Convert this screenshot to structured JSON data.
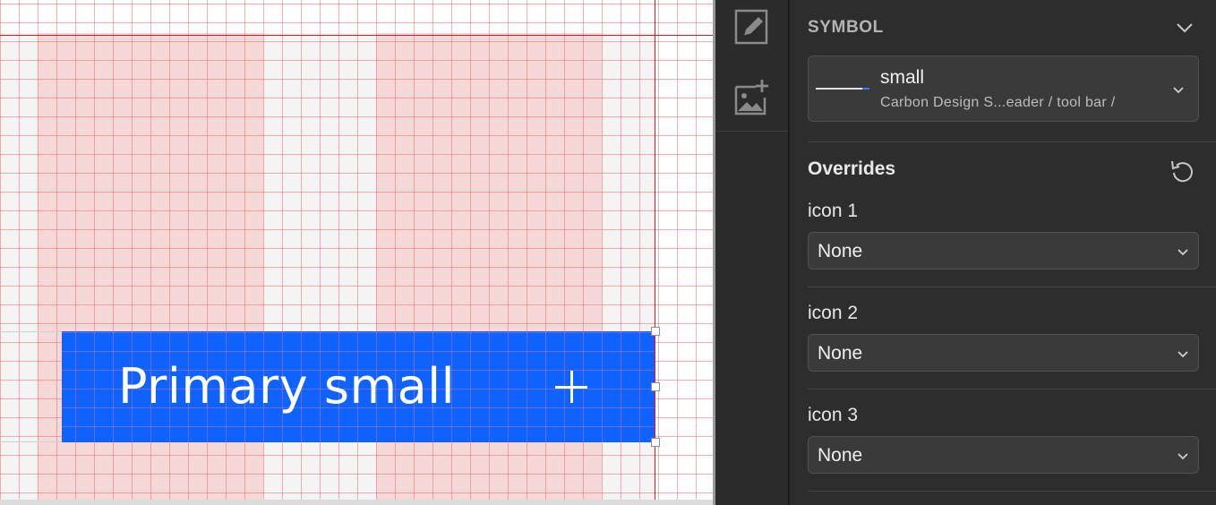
{
  "canvas": {
    "button_label": "Primary small"
  },
  "toolbar": {
    "tools": [
      {
        "name": "edit-symbol"
      },
      {
        "name": "add-image"
      }
    ]
  },
  "inspector": {
    "section_title": "SYMBOL",
    "symbol": {
      "name": "small",
      "path": "Carbon Design S...eader / tool bar /"
    },
    "overrides": {
      "title": "Overrides",
      "items": [
        {
          "label": "icon 1",
          "value": "None"
        },
        {
          "label": "icon 2",
          "value": "None"
        },
        {
          "label": "icon 3",
          "value": "None"
        }
      ]
    }
  },
  "colors": {
    "button_blue": "#0f62fe",
    "guide_red": "#e3171f",
    "panel_bg": "#2d2d2d",
    "field_bg": "#3a3a3a"
  }
}
